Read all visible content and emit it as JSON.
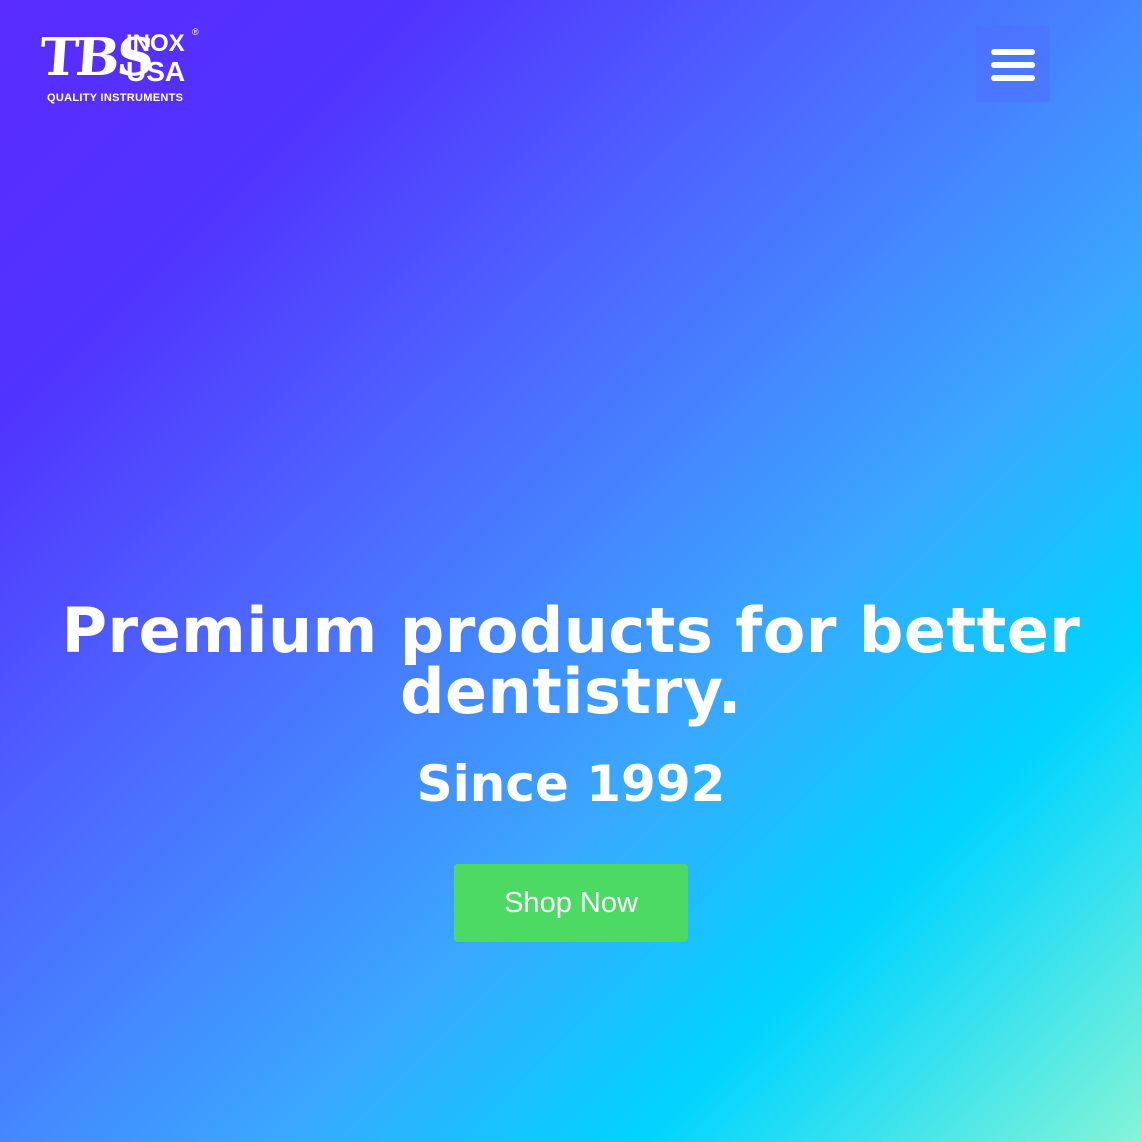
{
  "logo": {
    "mark": "TBS",
    "line1": "INOX",
    "line2": "USA",
    "registered": "®",
    "tagline": "QUALITY INSTRUMENTS"
  },
  "menu": {
    "icon": "hamburger-menu-icon"
  },
  "hero": {
    "headline_line1": "Premium products for better",
    "headline_line2": "dentistry.",
    "subheadline": "Since 1992",
    "cta_label": "Shop Now"
  },
  "colors": {
    "gradient_start": "#5a2cff",
    "gradient_middle": "#3aa8ff",
    "gradient_end": "#84f4d8",
    "cta_background": "#4cd964",
    "text": "#ffffff"
  }
}
